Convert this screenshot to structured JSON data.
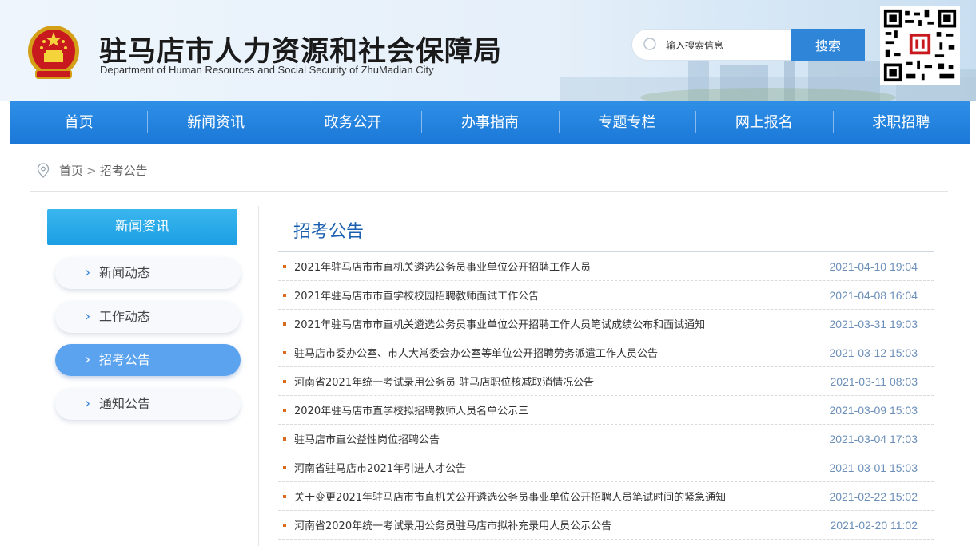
{
  "header": {
    "title": "驻马店市人力资源和社会保障局",
    "subtitle": "Department of Human Resources and Social Security of ZhuMadian City",
    "search_placeholder": "输入搜索信息",
    "search_button": "搜索",
    "emblem_icon": "national-emblem-icon",
    "qrcode_icon": "qrcode-icon"
  },
  "nav": {
    "items": [
      {
        "label": "首页"
      },
      {
        "label": "新闻资讯"
      },
      {
        "label": "政务公开"
      },
      {
        "label": "办事指南"
      },
      {
        "label": "专题专栏"
      },
      {
        "label": "网上报名"
      },
      {
        "label": "求职招聘"
      }
    ]
  },
  "breadcrumb": {
    "home": "首页",
    "separator": ">",
    "current": "招考公告"
  },
  "sidebar": {
    "heading": "新闻资讯",
    "items": [
      {
        "label": "新闻动态",
        "active": false
      },
      {
        "label": "工作动态",
        "active": false
      },
      {
        "label": "招考公告",
        "active": true
      },
      {
        "label": "通知公告",
        "active": false
      }
    ]
  },
  "main": {
    "title": "招考公告",
    "articles": [
      {
        "title": "2021年驻马店市市直机关遴选公务员事业单位公开招聘工作人员",
        "date": "2021-04-10 19:04"
      },
      {
        "title": "2021年驻马店市市直学校校园招聘教师面试工作公告",
        "date": "2021-04-08 16:04"
      },
      {
        "title": "2021年驻马店市市直机关遴选公务员事业单位公开招聘工作人员笔试成绩公布和面试通知",
        "date": "2021-03-31 19:03"
      },
      {
        "title": "驻马店市委办公室、市人大常委会办公室等单位公开招聘劳务派遣工作人员公告",
        "date": "2021-03-12 15:03"
      },
      {
        "title": "河南省2021年统一考试录用公务员 驻马店职位核减取消情况公告",
        "date": "2021-03-11 08:03"
      },
      {
        "title": "2020年驻马店市直学校拟招聘教师人员名单公示三",
        "date": "2021-03-09 15:03"
      },
      {
        "title": "驻马店市直公益性岗位招聘公告",
        "date": "2021-03-04 17:03"
      },
      {
        "title": "河南省驻马店市2021年引进人才公告",
        "date": "2021-03-01 15:03"
      },
      {
        "title": "关于变更2021年驻马店市市直机关公开遴选公务员事业单位公开招聘人员笔试时间的紧急通知",
        "date": "2021-02-22 15:02"
      },
      {
        "title": "河南省2020年统一考试录用公务员驻马店市拟补充录用人员公示公告",
        "date": "2021-02-20 11:02"
      }
    ]
  },
  "colors": {
    "nav_blue": "#1b78d8",
    "sidebar_head": "#1b9fe3",
    "active_item": "#5ba3ee",
    "title_blue": "#1a5fb0",
    "bullet_orange": "#d86a1d"
  }
}
